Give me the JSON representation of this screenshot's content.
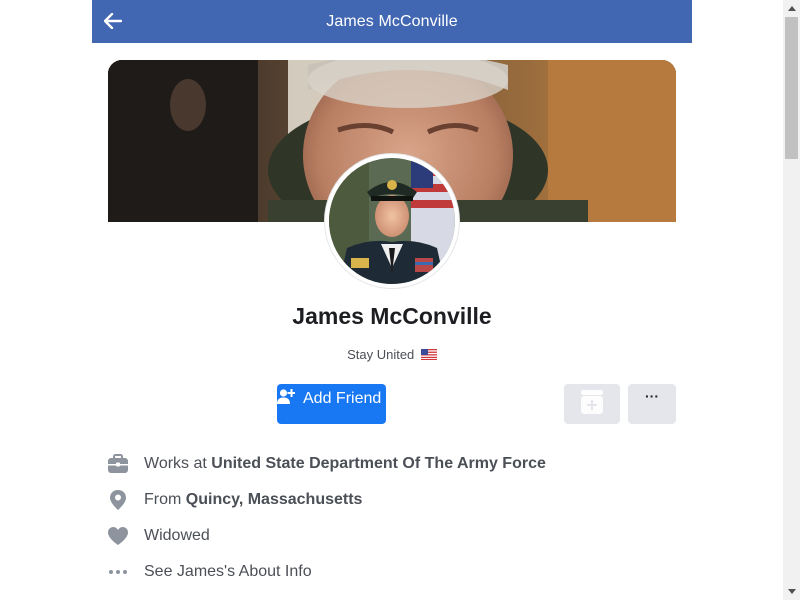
{
  "header": {
    "title": "James McConville",
    "back_icon": "arrow-left-icon",
    "background_color": "#4267b2"
  },
  "profile": {
    "name": "James McConville",
    "bio": "Stay United",
    "bio_flag_icon": "us-flag-icon"
  },
  "actions": {
    "add_friend_label": "Add Friend",
    "add_friend_icon": "add-friend-icon",
    "message_icon": "messenger-icon",
    "more_label": "···",
    "primary_color": "#1877f2",
    "secondary_color": "#e4e6eb"
  },
  "info": {
    "work_prefix": "Works at ",
    "work_place": "United State Department Of The Army Force",
    "from_prefix": "From ",
    "from_place": "Quincy, Massachusetts",
    "relationship": "Widowed",
    "about_link": "See James's About Info"
  },
  "icons": {
    "work": "briefcase-icon",
    "from": "location-pin-icon",
    "relationship": "heart-icon",
    "about": "ellipsis-icon"
  }
}
